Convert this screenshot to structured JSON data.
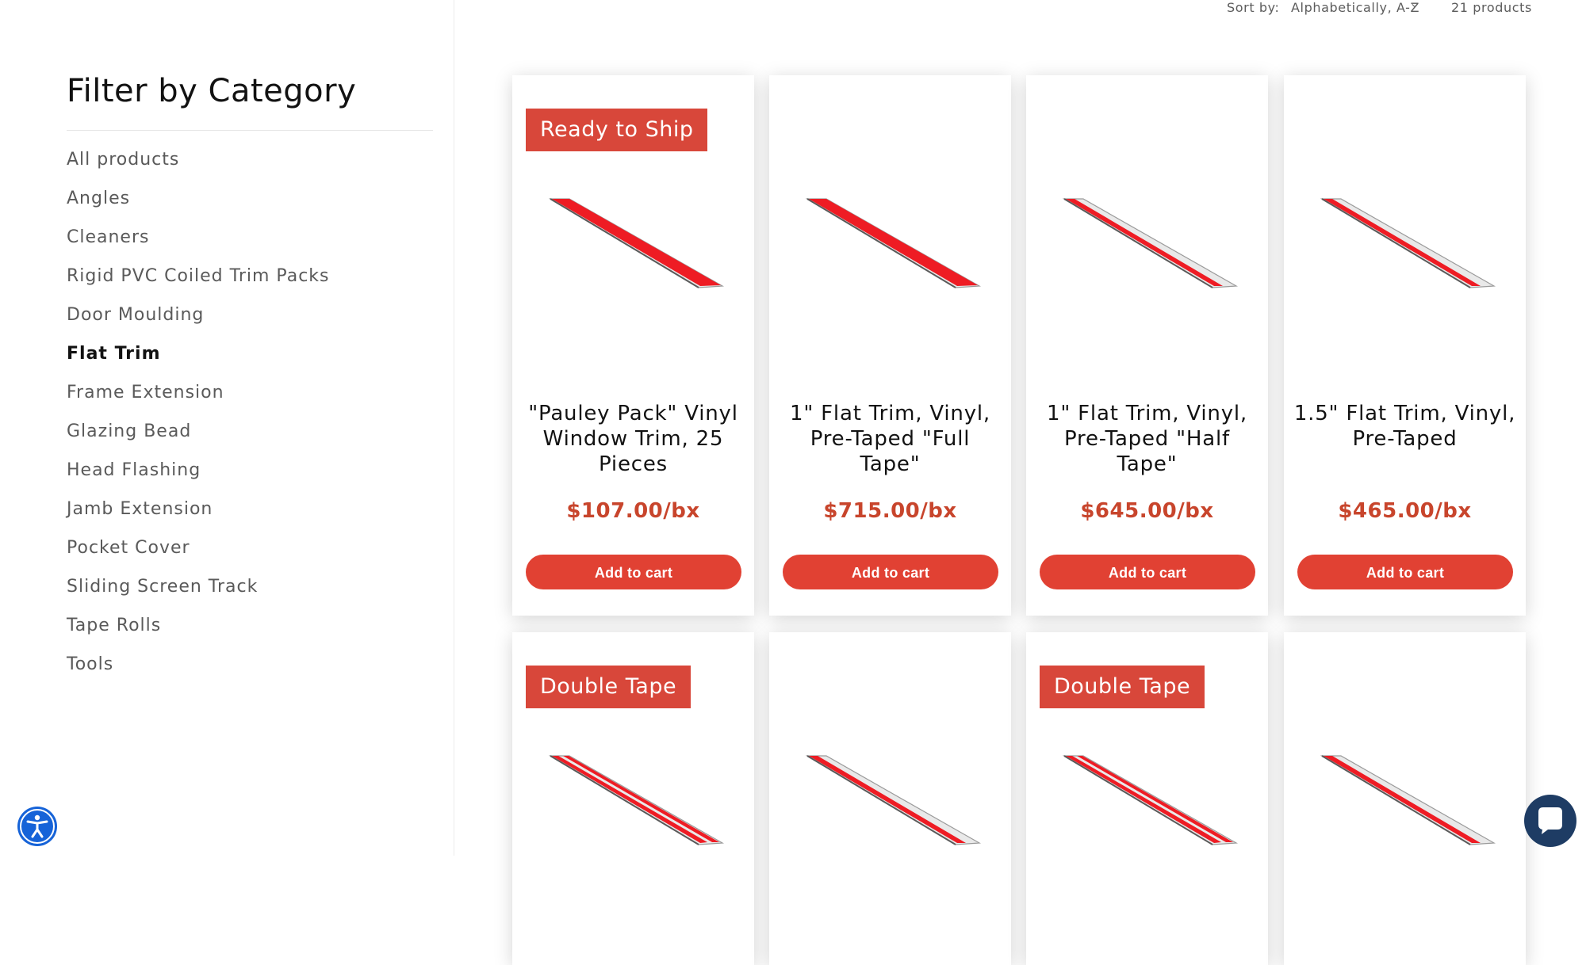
{
  "sidebar": {
    "title": "Filter by Category",
    "categories": [
      "All products",
      "Angles",
      "Cleaners",
      "Rigid PVC Coiled Trim Packs",
      "Door Moulding",
      "Flat Trim",
      "Frame Extension",
      "Glazing Bead",
      "Head Flashing",
      "Jamb Extension",
      "Pocket Cover",
      "Sliding Screen Track",
      "Tape Rolls",
      "Tools"
    ],
    "active_category": "Flat Trim"
  },
  "sort": {
    "label": "Sort by:",
    "selected": "Alphabetically, A-Z",
    "count": "21 products"
  },
  "products": [
    {
      "badge": "Ready to Ship",
      "title": "\"Pauley Pack\" Vinyl Window Trim, 25 Pieces",
      "price": "$107.00/bx",
      "button": "Add to cart",
      "tape": "full"
    },
    {
      "badge": "",
      "title": "1\" Flat Trim, Vinyl, Pre-Taped \"Full Tape\"",
      "price": "$715.00/bx",
      "button": "Add to cart",
      "tape": "full"
    },
    {
      "badge": "",
      "title": "1\" Flat Trim, Vinyl, Pre-Taped \"Half Tape\"",
      "price": "$645.00/bx",
      "button": "Add to cart",
      "tape": "half"
    },
    {
      "badge": "",
      "title": "1.5\" Flat Trim, Vinyl, Pre-Taped",
      "price": "$465.00/bx",
      "button": "Add to cart",
      "tape": "half"
    },
    {
      "badge": "Double Tape",
      "title": "",
      "price": "",
      "button": "",
      "tape": "double"
    },
    {
      "badge": "",
      "title": "",
      "price": "",
      "button": "",
      "tape": "half"
    },
    {
      "badge": "Double Tape",
      "title": "",
      "price": "",
      "button": "",
      "tape": "double"
    },
    {
      "badge": "",
      "title": "",
      "price": "",
      "button": "",
      "tape": "half"
    }
  ],
  "colors": {
    "accent": "#e14133",
    "price": "#c8452c",
    "badge": "#d8473a",
    "tape": "#ee1c24",
    "a11y": "#1663d8",
    "chat": "#1e3c64"
  },
  "icons": {
    "sort_chevron": "chevron-down-icon",
    "accessibility": "accessibility-icon",
    "chat": "chat-bubble-icon"
  }
}
